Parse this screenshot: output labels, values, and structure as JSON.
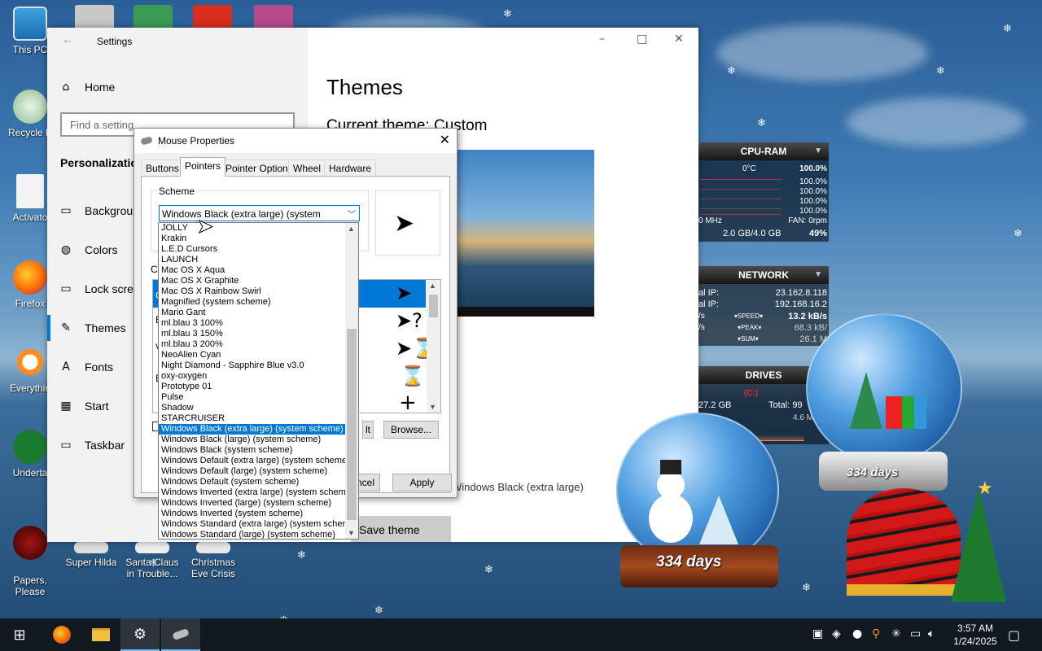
{
  "desktop": {
    "icons": [
      {
        "label": "This PC",
        "icon": "computer-icon"
      },
      {
        "label": "Recycle B",
        "icon": "recycle-bin-icon"
      },
      {
        "label": "Activato",
        "icon": "file-icon"
      },
      {
        "label": "Firefox",
        "icon": "firefox-icon"
      },
      {
        "label": "Everythin",
        "icon": "search-app-icon"
      },
      {
        "label": "Underta",
        "icon": "game-icon"
      },
      {
        "label": "Papers,\nPlease",
        "icon": "game-icon"
      }
    ],
    "bottom_icons": [
      {
        "label": "Super Hilda"
      },
      {
        "label": "Santa Claus in Trouble..."
      },
      {
        "label": "Christmas Eve Crisis"
      }
    ]
  },
  "settings": {
    "title": "Settings",
    "home": "Home",
    "search_placeholder": "Find a setting",
    "section": "Personalization",
    "nav": [
      "Background",
      "Colors",
      "Lock screen",
      "Themes",
      "Fonts",
      "Start",
      "Taskbar"
    ],
    "page_title": "Themes",
    "current_theme": "Current theme: Custom",
    "cursor_value": "Windows Black (extra large)",
    "save_theme": "Save theme"
  },
  "mouse": {
    "title": "Mouse Properties",
    "tabs": [
      "Buttons",
      "Pointers",
      "Pointer Options",
      "Wheel",
      "Hardware"
    ],
    "scheme_label": "Scheme",
    "scheme_value": "Windows Black (extra large) (system scheme)",
    "customize_label": "Cu",
    "browse": "Browse...",
    "cancel": "Cancel",
    "apply": "Apply",
    "partial_default": "lt",
    "partial_cancel": "ncel",
    "partial_e": "E",
    "partial_c": "C",
    "partial_v": "V",
    "partial_b": "B",
    "scheme_options": [
      "JOLLY",
      "Krakin",
      "L.E.D Cursors",
      "LAUNCH",
      "Mac OS X Aqua",
      "Mac OS X Graphite",
      "Mac OS X Rainbow Swirl",
      "Magnified (system scheme)",
      "Mario Gant",
      "ml.blau 3 100%",
      "ml.blau 3 150%",
      "ml.blau 3 200%",
      "NeoAlien Cyan",
      "Night Diamond - Sapphire Blue v3.0",
      "oxy-oxygen",
      "Prototype 01",
      "Pulse",
      "Shadow",
      "STARCRUISER",
      "Windows Black (extra large) (system scheme)",
      "Windows Black (large) (system scheme)",
      "Windows Black (system scheme)",
      "Windows Default (extra large) (system scheme)",
      "Windows Default (large) (system scheme)",
      "Windows Default (system scheme)",
      "Windows Inverted (extra large) (system scheme)",
      "Windows Inverted (large) (system scheme)",
      "Windows Inverted (system scheme)",
      "Windows Standard (extra large) (system scheme)",
      "Windows Standard (large) (system scheme)"
    ],
    "selected_index": 19
  },
  "gadgets": {
    "cpu": {
      "title": "CPU-RAM",
      "temp": "0°C",
      "total": "100.0%",
      "cores": [
        "100.0%",
        "100.0%",
        "100.0%",
        "100.0%"
      ],
      "mhz": "0 MHz",
      "fan": "FAN: 0rpm",
      "ram": "2.0 GB/4.0 GB",
      "ram_pct": "49%"
    },
    "network": {
      "title": "NETWORK",
      "ip1_label": "al IP:",
      "ip1": "23.162.8.118",
      "ip2_label": "al IP:",
      "ip2": "192.168.16.2",
      "speed_label": "SPEED",
      "speed": "13.2 kB/s",
      "peak_label": "PEAK",
      "peak": "68.3 kB/",
      "sum_label": "SUM",
      "sum": "26.1 M",
      "s1": "/s",
      "s2": "/s"
    },
    "drives": {
      "title": "DRIVES",
      "drive": "(C:)",
      "used": "27.2 GB",
      "total": "Total: 99",
      "free": "4.6 M"
    }
  },
  "globes": {
    "left_text": "334 days",
    "right_text": "334 days"
  },
  "taskbar": {
    "time": "3:57 AM",
    "date": "1/24/2025"
  },
  "colors": {
    "accent": "#0078d7",
    "taskbar": "#101820"
  }
}
